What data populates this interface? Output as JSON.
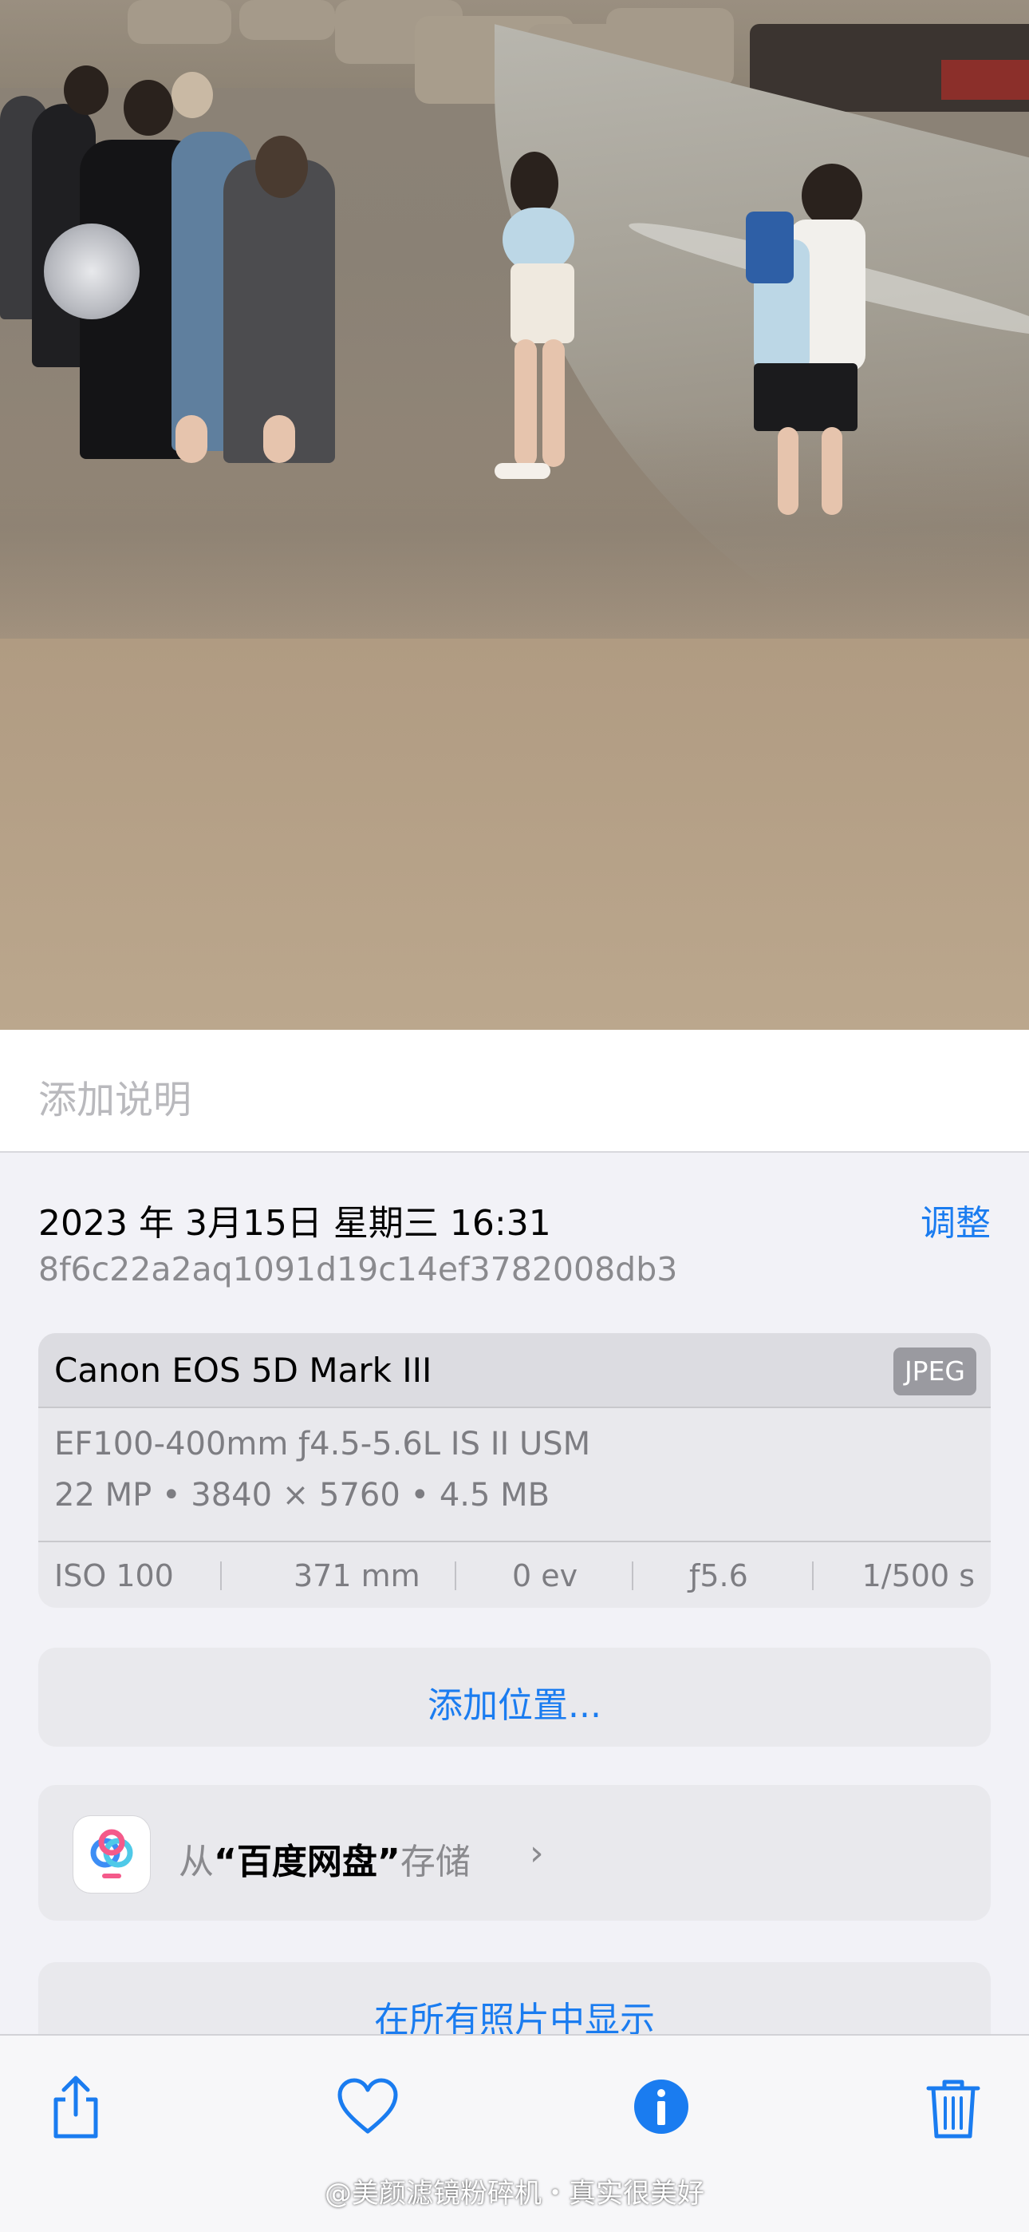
{
  "caption": {
    "placeholder": "添加说明"
  },
  "info": {
    "datetime": "2023 年 3月15日 星期三 16:31",
    "adjust_label": "调整",
    "filename": "8f6c22a2aq1091d19c14ef3782008db3"
  },
  "camera_card": {
    "camera": "Canon EOS 5D Mark III",
    "format_badge": "JPEG",
    "lens": "EF100-400mm ƒ4.5-5.6L IS II USM",
    "specs": "22 MP • 3840 × 5760 • 4.5 MB",
    "exif": {
      "iso": "ISO 100",
      "focal": "371 mm",
      "ev": "0 ev",
      "aperture": "ƒ5.6",
      "shutter": "1/500 s"
    }
  },
  "add_location": {
    "label": "添加位置..."
  },
  "store": {
    "prefix": "从",
    "app_name": "“百度网盘”",
    "suffix": "存储",
    "chevron": "›",
    "icon": "baidu-netdisk-icon"
  },
  "show_all": {
    "label": "在所有照片中显示"
  },
  "toolbar": {
    "icons": [
      "share-icon",
      "heart-icon",
      "info-icon",
      "trash-icon"
    ],
    "accent_color": "#1a7cf0"
  },
  "watermark": "@美颜滤镜粉碎机・真实很美好"
}
